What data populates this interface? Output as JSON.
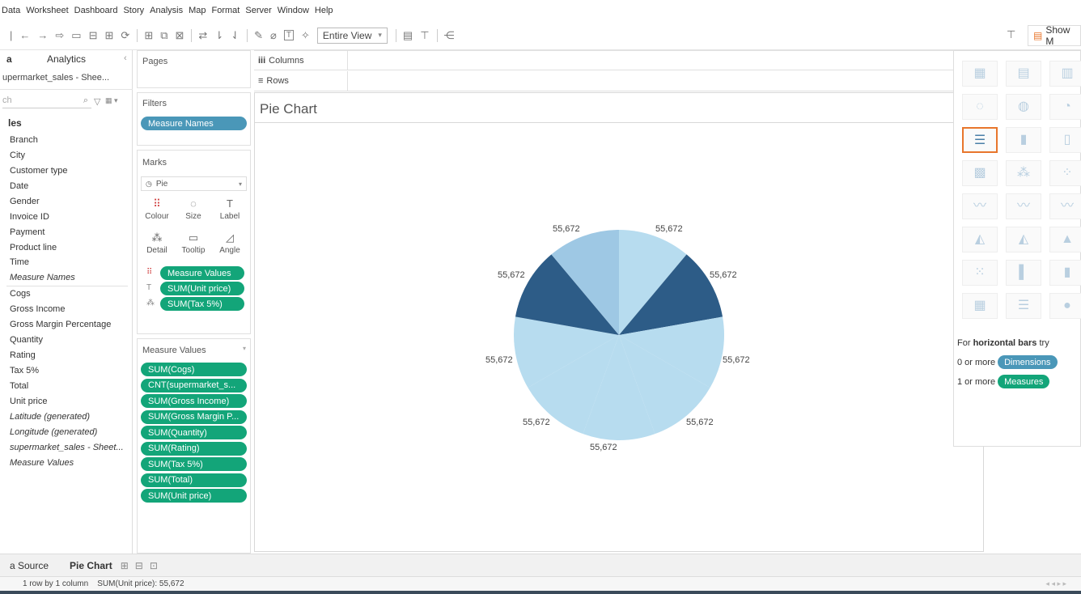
{
  "menu": [
    "Data",
    "Worksheet",
    "Dashboard",
    "Story",
    "Analysis",
    "Map",
    "Format",
    "Server",
    "Window",
    "Help"
  ],
  "toolbar": {
    "fit": "Entire View",
    "show_me": "Show M"
  },
  "data_pane": {
    "tab_data": "a",
    "tab_analytics": "Analytics",
    "source": "upermarket_sales - Shee...",
    "search_placeholder": "ch",
    "tables_header": "les",
    "dimensions": [
      "Branch",
      "City",
      "Customer type",
      "Date",
      "Gender",
      "Invoice ID",
      "Payment",
      "Product line",
      "Time",
      "Measure Names"
    ],
    "measures": [
      "Cogs",
      "Gross Income",
      "Gross Margin Percentage",
      "Quantity",
      "Rating",
      "Tax 5%",
      "Total",
      "Unit price",
      "Latitude (generated)",
      "Longitude (generated)",
      "supermarket_sales - Sheet...",
      "Measure Values"
    ]
  },
  "cards": {
    "pages": "Pages",
    "filters": "Filters",
    "filter_pill": "Measure Names",
    "marks": "Marks",
    "mark_type": "Pie",
    "mark_buttons": [
      "Colour",
      "Size",
      "Label",
      "Detail",
      "Tooltip",
      "Angle"
    ],
    "mark_pills": [
      "Measure Values",
      "SUM(Unit price)",
      "SUM(Tax 5%)"
    ],
    "measure_values_title": "Measure Values",
    "measure_values": [
      "SUM(Cogs)",
      "CNT(supermarket_s...",
      "SUM(Gross Income)",
      "SUM(Gross Margin P...",
      "SUM(Quantity)",
      "SUM(Rating)",
      "SUM(Tax 5%)",
      "SUM(Total)",
      "SUM(Unit price)"
    ]
  },
  "shelves": {
    "columns": "Columns",
    "rows": "Rows"
  },
  "sheet_title": "Pie Chart",
  "pie": {
    "labels": [
      "55,672",
      "55,672",
      "55,672",
      "55,672",
      "55,672",
      "55,672",
      "55,672",
      "55,672",
      "55,672"
    ],
    "colors": [
      "#b7dcef",
      "#2d5c87",
      "#b7dcef",
      "#b7dcef",
      "#b7dcef",
      "#b7dcef",
      "#b7dcef",
      "#2d5c87",
      "#9ec8e4"
    ]
  },
  "show_me": {
    "hint_prefix": "For",
    "hint_bold": "horizontal bars",
    "hint_suffix": "try",
    "dim_prefix": "0 or more",
    "dim_pill": "Dimensions",
    "meas_prefix": "1 or more",
    "meas_pill": "Measures"
  },
  "tabs": {
    "data_source": "a Source",
    "active": "Pie Chart"
  },
  "status": "1 row by 1 column    SUM(Unit price): 55,672"
}
